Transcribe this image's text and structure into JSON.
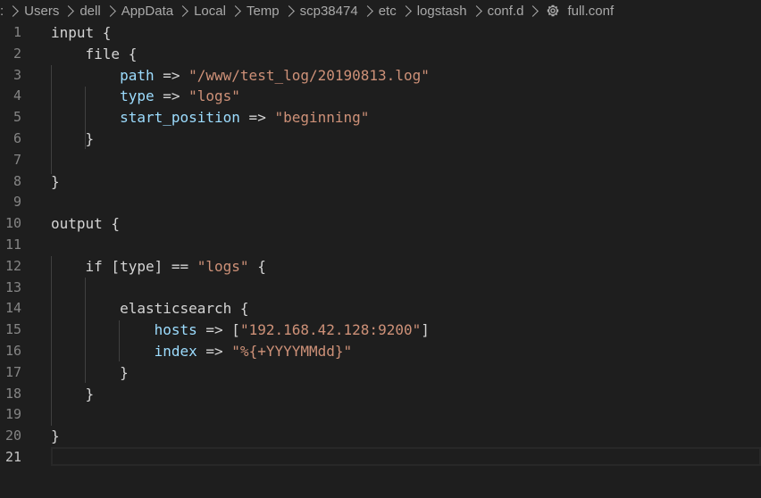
{
  "breadcrumb": {
    "leading": ":",
    "items": [
      "Users",
      "dell",
      "AppData",
      "Local",
      "Temp",
      "scp38474",
      "etc",
      "logstash",
      "conf.d"
    ],
    "file_icon": "gear-icon",
    "file_name": "full.conf"
  },
  "editor": {
    "current_line": 21,
    "lines": [
      {
        "n": "1",
        "text": "input {"
      },
      {
        "n": "2",
        "text": "    file {"
      },
      {
        "n": "3",
        "key": "path",
        "op": " => ",
        "str": "\"/www/test_log/20190813.log\""
      },
      {
        "n": "4",
        "key": "type",
        "op": " => ",
        "str": "\"logs\""
      },
      {
        "n": "5",
        "key": "start_position",
        "op": " => ",
        "str": "\"beginning\""
      },
      {
        "n": "6",
        "text": "    }"
      },
      {
        "n": "7",
        "text": ""
      },
      {
        "n": "8",
        "text": "}"
      },
      {
        "n": "9",
        "text": ""
      },
      {
        "n": "10",
        "text": "output {"
      },
      {
        "n": "11",
        "text": ""
      },
      {
        "n": "12",
        "text_pre": "    if [type] == ",
        "str": "\"logs\"",
        "text_post": " {"
      },
      {
        "n": "13",
        "text": ""
      },
      {
        "n": "14",
        "text": "        elasticsearch {"
      },
      {
        "n": "15",
        "key": "hosts",
        "op": " => [",
        "str": "\"192.168.42.128:9200\"",
        "text_post": "]"
      },
      {
        "n": "16",
        "key": "index",
        "op": " => ",
        "str": "\"%{+YYYYMMdd}\""
      },
      {
        "n": "17",
        "text": "        }"
      },
      {
        "n": "18",
        "text": "    }"
      },
      {
        "n": "19",
        "text": ""
      },
      {
        "n": "20",
        "text": "}"
      },
      {
        "n": "21",
        "text": ""
      }
    ]
  },
  "colors": {
    "background": "#1e1e1e",
    "line_number": "#858585",
    "default_text": "#d4d4d4",
    "key": "#9cdcfe",
    "string": "#ce9178",
    "breadcrumb": "#a9a9a9"
  }
}
